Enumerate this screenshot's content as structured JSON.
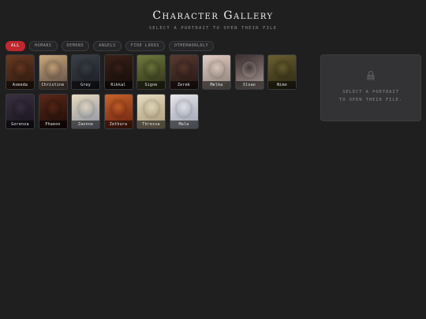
{
  "header": {
    "title": "Character Gallery",
    "subtitle": "SELECT A PORTRAIT TO OPEN THEIR FILE"
  },
  "filters": [
    {
      "label": "ALL",
      "active": true
    },
    {
      "label": "HUMANS",
      "active": false
    },
    {
      "label": "DEMONS",
      "active": false
    },
    {
      "label": "ANGELS",
      "active": false
    },
    {
      "label": "FIRE LORDS",
      "active": false
    },
    {
      "label": "OTHERWORLDLY",
      "active": false
    }
  ],
  "characters": [
    {
      "name": "Asmeda",
      "colors": [
        "#6a3a22",
        "#2a1810"
      ]
    },
    {
      "name": "Christine",
      "colors": [
        "#c9a77a",
        "#5a4a44"
      ]
    },
    {
      "name": "Grey",
      "colors": [
        "#3a4048",
        "#1a1d22"
      ]
    },
    {
      "name": "Rikkal",
      "colors": [
        "#3a2218",
        "#140c0a"
      ]
    },
    {
      "name": "Signe",
      "colors": [
        "#6f7a3c",
        "#2c3018"
      ]
    },
    {
      "name": "Zerek",
      "colors": [
        "#5a3a30",
        "#221614"
      ]
    },
    {
      "name": "Melka",
      "colors": [
        "#e2ccc2",
        "#8a8078"
      ]
    },
    {
      "name": "Sloan",
      "colors": [
        "#3a2e30",
        "#a89a94"
      ]
    },
    {
      "name": "Nimo",
      "colors": [
        "#6a6030",
        "#2a2612"
      ]
    },
    {
      "name": "Gorenza",
      "colors": [
        "#3a3040",
        "#181420"
      ]
    },
    {
      "name": "Phaeon",
      "colors": [
        "#5a2818",
        "#1c0c08"
      ]
    },
    {
      "name": "Zaonne",
      "colors": [
        "#e8dcc0",
        "#8a90a0"
      ]
    },
    {
      "name": "Zethura",
      "colors": [
        "#c8642a",
        "#6a2010"
      ]
    },
    {
      "name": "Thressa",
      "colors": [
        "#e6dcc0",
        "#a89a78"
      ]
    },
    {
      "name": "Mala",
      "colors": [
        "#e8e8ec",
        "#9aa0b0"
      ]
    }
  ],
  "panel": {
    "icon": "lock-icon",
    "line1": "SELECT A PORTRAIT",
    "line2": "TO OPEN THEIR FILE."
  },
  "accent": "#c0282e"
}
